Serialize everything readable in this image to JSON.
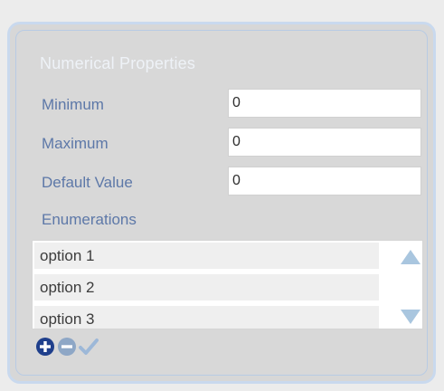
{
  "panel": {
    "title": "Numerical Properties"
  },
  "fields": {
    "minimum": {
      "label": "Minimum",
      "value": "0"
    },
    "maximum": {
      "label": "Maximum",
      "value": "0"
    },
    "default_value": {
      "label": "Default Value",
      "value": "0"
    }
  },
  "enumerations": {
    "label": "Enumerations",
    "items": [
      "option 1",
      "option 2",
      "option 3"
    ]
  },
  "actions": {
    "icons": [
      "plus-circle-icon",
      "minus-circle-icon",
      "checkmark-icon"
    ],
    "colors": {
      "add": "#1f3f8c",
      "remove": "#8ea7c6",
      "confirm": "#9db8d8"
    }
  },
  "colors": {
    "label_text": "#5d78a8",
    "title_text": "#eef2f7",
    "panel_border": "#c9d9ee",
    "panel_background": "#d8d8d8",
    "scroll_arrow": "#a9c6df"
  }
}
